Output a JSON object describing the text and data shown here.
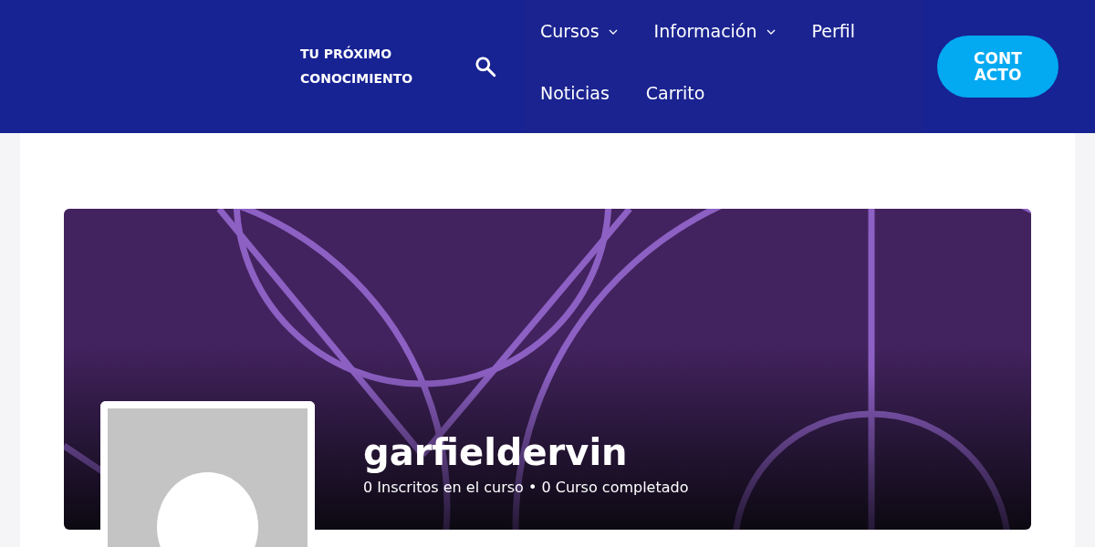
{
  "header": {
    "site_title": "TU PRÓXIMO CONOCIMIENTO",
    "nav": [
      {
        "label": "Cursos",
        "has_dropdown": true
      },
      {
        "label": "Información",
        "has_dropdown": true
      },
      {
        "label": "Perfil",
        "has_dropdown": false
      },
      {
        "label": "Noticias",
        "has_dropdown": false
      },
      {
        "label": "Carrito",
        "has_dropdown": false
      }
    ],
    "contact_button": "CONT ACTO"
  },
  "profile": {
    "username": "garfieldervin",
    "stats": "0 Inscritos en el curso • 0 Curso completado"
  }
}
